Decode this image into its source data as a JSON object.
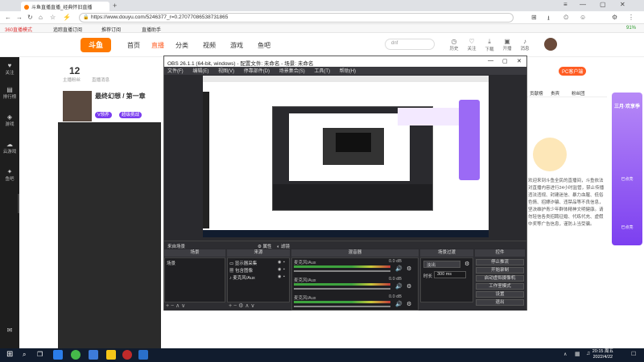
{
  "browser": {
    "tab_title": "斗鱼直播直播_经典怀旧直播",
    "url": "https://www.douyu.com/5246377_r=0.27077086538731865",
    "bookmarks": [
      "360直播模式",
      "追踪直播订阅",
      "推荐订阅",
      "直播助手"
    ],
    "ext_label": "91%"
  },
  "douyu": {
    "logo": "斗鱼",
    "nav": [
      "首页",
      "直播",
      "分类",
      "视频",
      "游戏",
      "鱼吧"
    ],
    "search_placeholder": "dnf",
    "header_icons": [
      "历史",
      "关注",
      "下载",
      "开播",
      "消息"
    ],
    "stats": [
      {
        "value": "12",
        "label": "主播粉丝"
      },
      {
        "label": "直播消息"
      }
    ],
    "room_title": "最终幻想 / 第一章",
    "tags": [
      "V领养",
      "超级挑战"
    ],
    "right_tabs": [
      "贡献榜",
      "贵宾",
      "粉丝团"
    ],
    "promo_btn": "PC客户端",
    "chat_text": "欢迎来到斗鱼全民的直播间，斗鱼依法对直播内容进行24小时监管，禁止传播违法违规、封建迷信、暴力血腥、低俗色情、招嫖诈骗、违禁品等不良信息，坚决维护青少年群体精神文明健康。请勿轻信各类招聘征婚、代练代充、虚假中奖等广告信息，谨防上当受骗。",
    "sidebar_left": [
      "关注",
      "排行榜",
      "游戏",
      "云游戏",
      "鱼吧"
    ],
    "promo_right": [
      "三月·欢享季",
      "已点亮",
      "已点亮"
    ]
  },
  "obs": {
    "title": "OBS 26.1.1 (64-bit, windows) - 配置文件: 未命名 - 场景: 未命名",
    "menu": [
      "文件(F)",
      "编辑(E)",
      "视图(V)",
      "停靠部件(D)",
      "场景集合(S)",
      "工具(T)",
      "帮助(H)"
    ],
    "filter_label": "来自场景",
    "filter_btn": "属性",
    "filter_btn2": "滤镜",
    "docks": {
      "scenes": "场景",
      "sources": "来源",
      "mixer": "混音器",
      "transitions": "场景过渡",
      "controls": "控件"
    },
    "scene_items": [
      "场景"
    ],
    "source_items": [
      "显示器采集",
      "包含图像",
      "麦克风/Aux"
    ],
    "mixer_items": [
      {
        "name": "麦克风/Aux",
        "level": "0.0 dB"
      },
      {
        "name": "麦克风/Aux",
        "level": "0.0 dB"
      },
      {
        "name": "麦克风/Aux",
        "level": "0.0 dB"
      }
    ],
    "transition_type": "淡出",
    "duration_label": "时长",
    "duration_value": "300 ms",
    "controls": [
      "停止推流",
      "开始录制",
      "启动虚拟摄像机",
      "工作室模式",
      "设置",
      "退出"
    ]
  },
  "taskbar": {
    "time": "20:15 周五",
    "date": "2022/4/22"
  }
}
